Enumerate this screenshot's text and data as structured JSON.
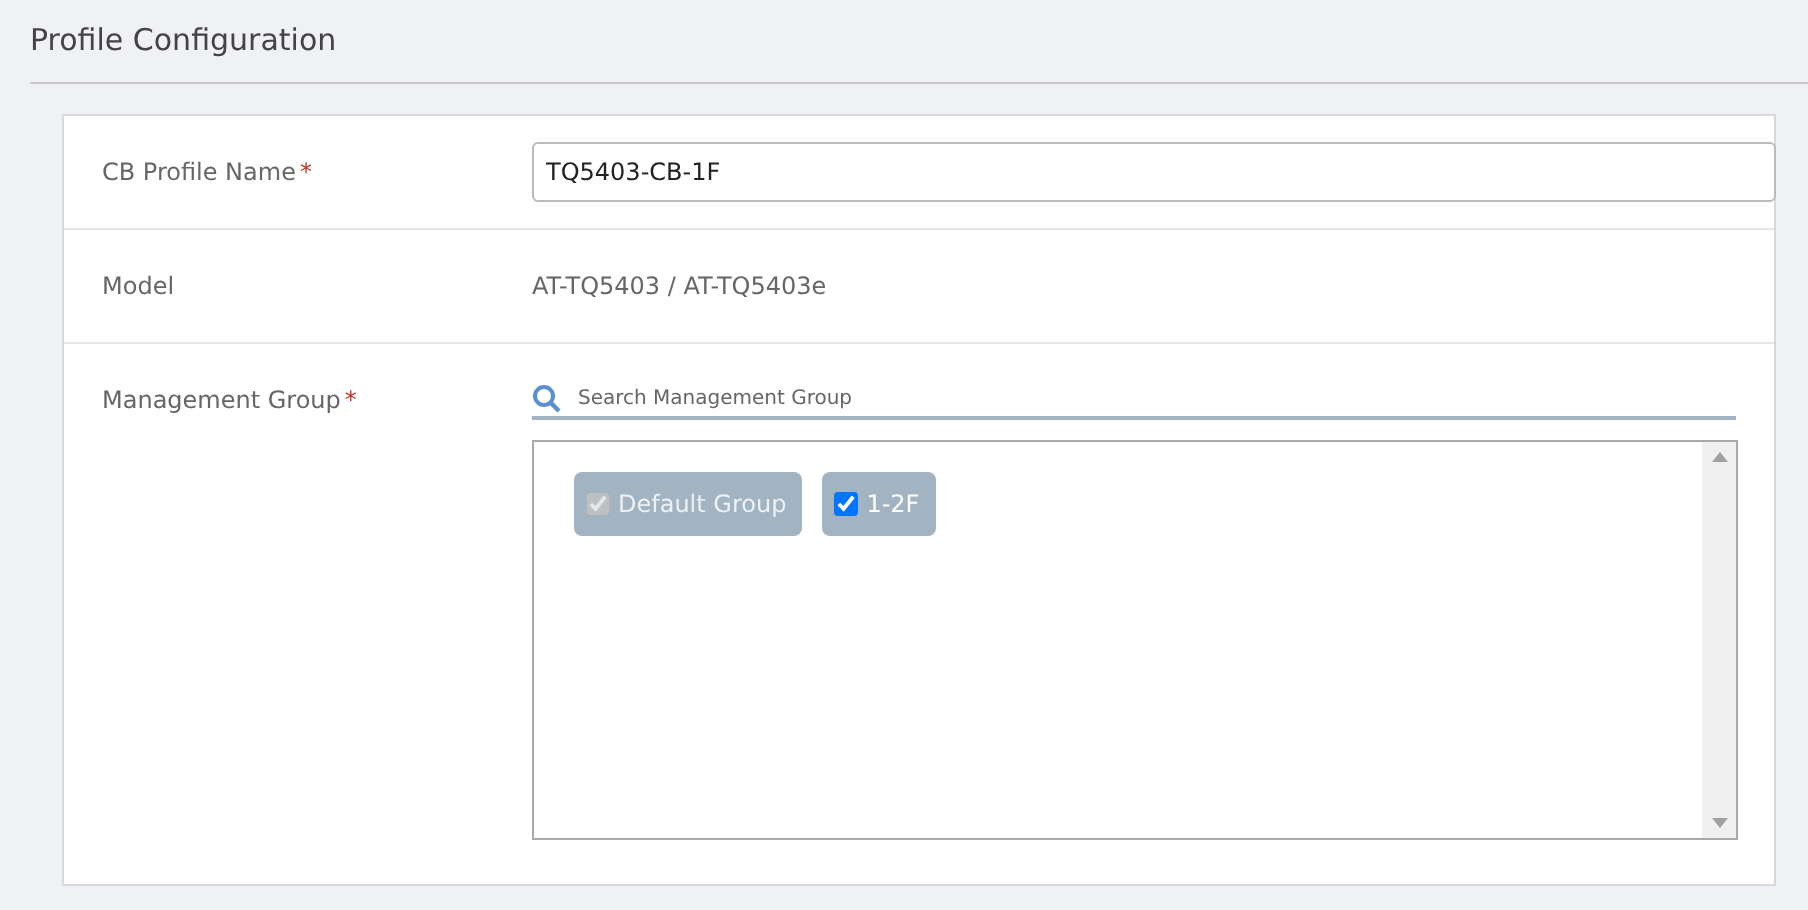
{
  "page_title": "Profile Configuration",
  "profile_name": {
    "label": "CB Profile Name",
    "required_mark": "*",
    "value": "TQ5403-CB-1F"
  },
  "model": {
    "label": "Model",
    "value": "AT-TQ5403 / AT-TQ5403e"
  },
  "management_group": {
    "label": "Management Group",
    "required_mark": "*",
    "search": {
      "placeholder": "Search Management Group"
    },
    "groups": [
      {
        "label": "Default Group",
        "checked": true,
        "disabled": true
      },
      {
        "label": "1-2F",
        "checked": true,
        "disabled": false
      }
    ]
  }
}
